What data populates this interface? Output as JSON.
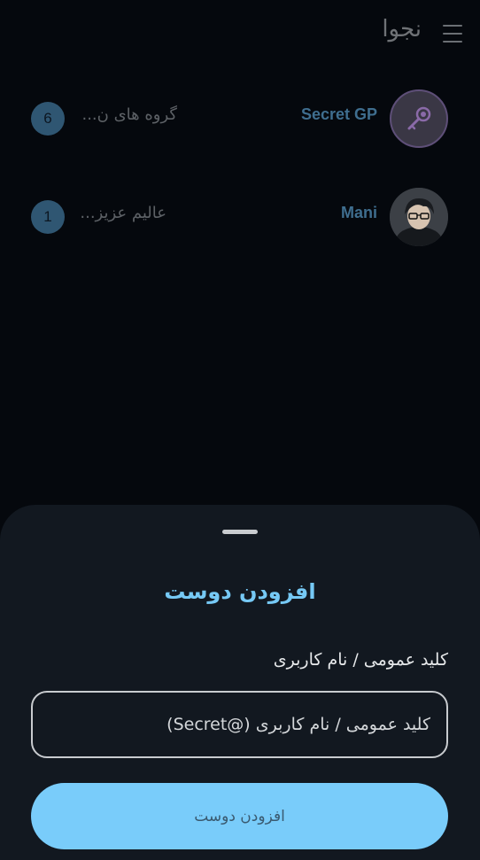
{
  "header": {
    "title": "نجوا",
    "menu_icon": "menu-icon"
  },
  "chats": [
    {
      "name": "Secret GP",
      "preview": "گروه های ن...",
      "unread": "6",
      "avatar_icon": "key-icon"
    },
    {
      "name": "Mani",
      "preview": "عالیم عزیز...",
      "unread": "1",
      "avatar_icon": "profile-photo"
    }
  ],
  "sheet": {
    "title": "افزودن دوست",
    "field_label": "کلید عمومی / نام کاربری",
    "input_placeholder": "کلید عمومی / نام کاربری (@Secret)",
    "input_value": "",
    "submit_label": "افزودن دوست"
  },
  "colors": {
    "background": "#05080d",
    "sheet": "#121820",
    "accent": "#79ccfa",
    "badge": "#2f5672",
    "chat_name": "#3f6e8f"
  }
}
